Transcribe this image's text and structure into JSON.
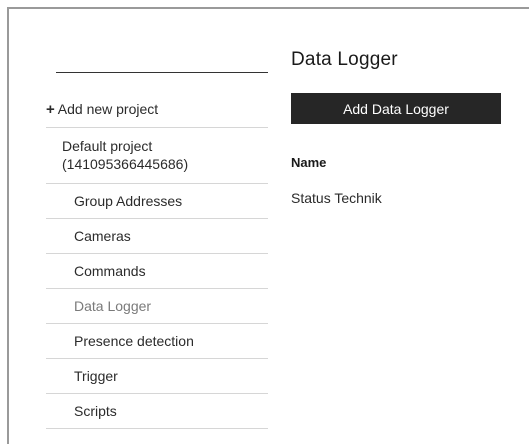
{
  "sidebar": {
    "add_project": {
      "icon": "plus-icon",
      "plus_glyph": "+",
      "label": "Add new project"
    },
    "project": {
      "name_line1": "Default project",
      "name_line2": "(141095366445686)"
    },
    "items": [
      {
        "label": "Group Addresses"
      },
      {
        "label": "Cameras"
      },
      {
        "label": "Commands"
      },
      {
        "label": "Data Logger",
        "active": true
      },
      {
        "label": "Presence detection"
      },
      {
        "label": "Trigger"
      },
      {
        "label": "Scripts"
      }
    ]
  },
  "main": {
    "title": "Data Logger",
    "add_button_label": "Add Data Logger",
    "table": {
      "columns": [
        "Name"
      ],
      "rows": [
        [
          "Status Technik"
        ]
      ]
    }
  },
  "colors": {
    "button_bg": "#262626",
    "button_text": "#ffffff",
    "active_item_text": "#7a7a7a",
    "divider": "#d6d6d6"
  }
}
